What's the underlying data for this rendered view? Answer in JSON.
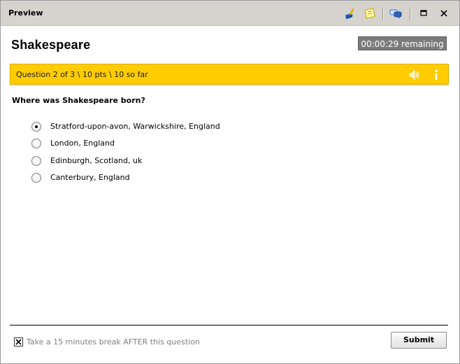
{
  "window": {
    "title": "Preview"
  },
  "toolbar": {
    "icons": [
      "brush-icon",
      "notes-icon",
      "chat-icon"
    ],
    "maximize_glyph": "☐",
    "close_glyph": "✕"
  },
  "quiz": {
    "title": "Shakespeare",
    "timer": "00:00:29 remaining",
    "progress": "Question 2 of 3 \\ 10 pts \\ 10 so far",
    "question": "Where was Shakespeare born?",
    "options": [
      {
        "label": "Stratford-upon-avon, Warwickshire, England",
        "selected": true
      },
      {
        "label": "London, England",
        "selected": false
      },
      {
        "label": "Edinburgh, Scotland, uk",
        "selected": false
      },
      {
        "label": "Canterbury, England",
        "selected": false
      }
    ]
  },
  "footer": {
    "break_label": "Take a 15 minutes break AFTER this question",
    "break_checked": true,
    "submit_label": "Submit"
  },
  "colors": {
    "progress_bar": "#ffcc00",
    "timer_bg": "#7b7b7b",
    "titlebar_bg": "#d6d3ce"
  }
}
